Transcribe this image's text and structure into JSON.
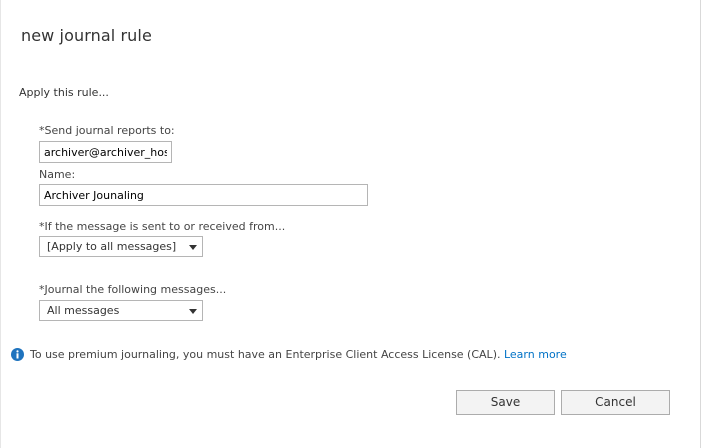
{
  "dialog": {
    "title": "new journal rule",
    "section_heading": "Apply this rule..."
  },
  "form": {
    "send_reports_label": "*Send journal reports to:",
    "send_reports_value": "archiver@archiver_hostr",
    "name_label": "Name:",
    "name_value": "Archiver Jounaling",
    "scope_label": "*If the message is sent to or received from...",
    "scope_selected": "[Apply to all messages]",
    "journal_label": "*Journal the following messages...",
    "journal_selected": "All messages"
  },
  "info": {
    "icon": "info-icon",
    "text": "To use premium journaling, you must have an Enterprise Client Access License (CAL).",
    "link_text": "Learn more"
  },
  "buttons": {
    "save_label": "Save",
    "cancel_label": "Cancel"
  },
  "colors": {
    "link": "#0072c6",
    "info_icon": "#1e73be",
    "button_bg": "#f3f3f3",
    "border": "#b5b5b5"
  }
}
